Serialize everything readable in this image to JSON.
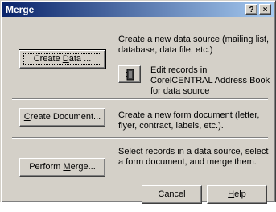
{
  "window": {
    "title": "Merge",
    "help_glyph": "?",
    "close_glyph": "×"
  },
  "create_data": {
    "button_pre": "Create ",
    "button_accel": "D",
    "button_post": "ata ...",
    "description": "Create a new data source (mailing list, database, data file, etc.)",
    "edit_records_text": "Edit records in CorelCENTRAL Address Book for data source",
    "edit_icon": "address-book-icon"
  },
  "create_document": {
    "button_accel": "C",
    "button_post": "reate Document...",
    "description": "Create a new form document (letter, flyer, contract, labels, etc.)."
  },
  "perform_merge": {
    "button_pre": "Perform ",
    "button_accel": "M",
    "button_post": "erge...",
    "description": "Select records in a data source, select a form document, and merge them."
  },
  "footer": {
    "cancel_label": "Cancel",
    "help_accel": "H",
    "help_post": "elp"
  }
}
